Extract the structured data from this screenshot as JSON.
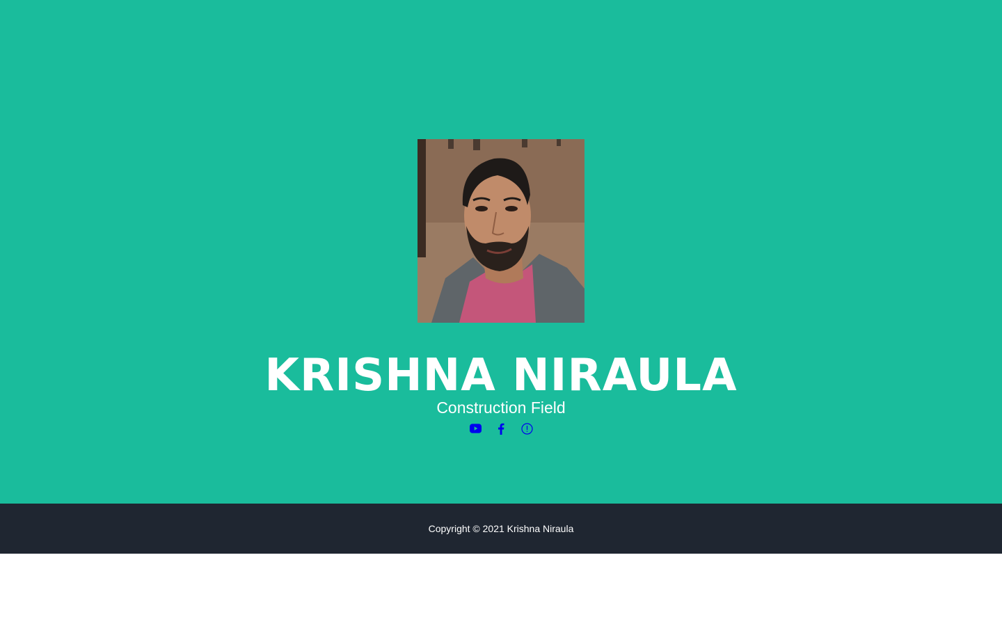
{
  "profile": {
    "name": "KRISHNA NIRAULA",
    "subtitle": "Construction Field",
    "photo_alt": "Profile photo"
  },
  "social": [
    {
      "icon": "youtube-icon",
      "label": "YouTube"
    },
    {
      "icon": "facebook-icon",
      "label": "Facebook"
    },
    {
      "icon": "info-icon",
      "label": "Info"
    }
  ],
  "footer": {
    "copyright": "Copyright © 2021 Krishna Niraula"
  },
  "colors": {
    "masthead_bg": "#1abc9c",
    "footer_bg": "#1f2631",
    "link": "#0000ee",
    "text": "#ffffff"
  }
}
